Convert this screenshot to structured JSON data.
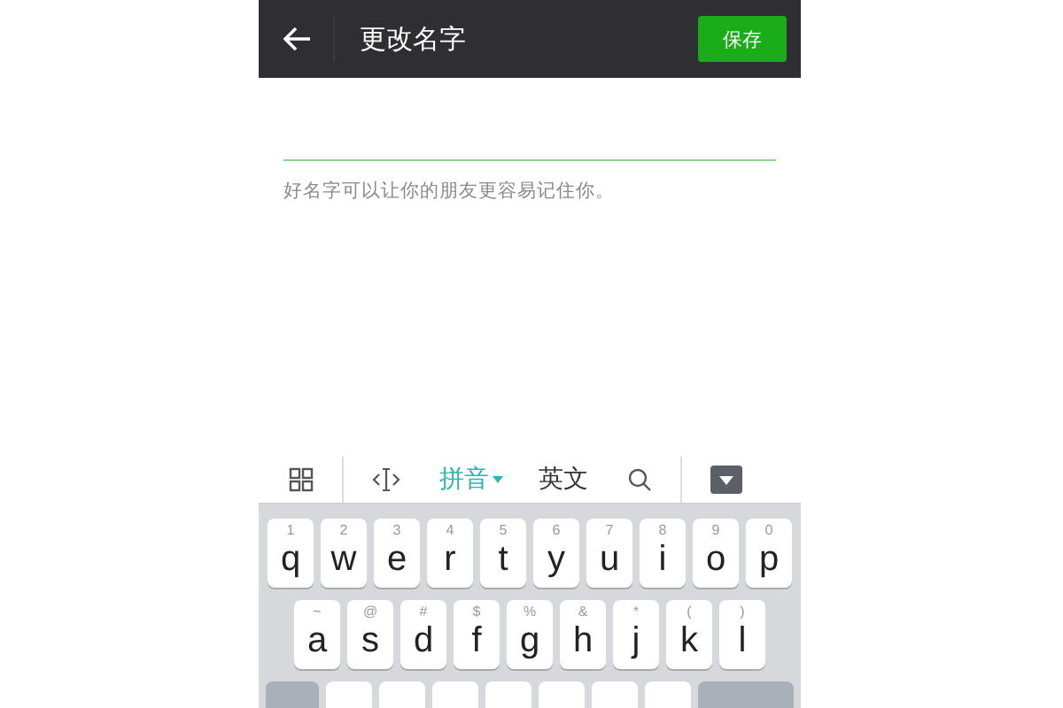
{
  "header": {
    "title": "更改名字",
    "save_button": "保存"
  },
  "name_field": {
    "help_text": "好名字可以让你的朋友更容易记住你。"
  },
  "keyboard": {
    "modes": [
      {
        "label": "拼音",
        "selected": true
      },
      {
        "label": "英文",
        "selected": false
      }
    ],
    "rows": [
      [
        {
          "key": "q",
          "hint": "1"
        },
        {
          "key": "w",
          "hint": "2"
        },
        {
          "key": "e",
          "hint": "3"
        },
        {
          "key": "r",
          "hint": "4"
        },
        {
          "key": "t",
          "hint": "5"
        },
        {
          "key": "y",
          "hint": "6"
        },
        {
          "key": "u",
          "hint": "7"
        },
        {
          "key": "i",
          "hint": "8"
        },
        {
          "key": "o",
          "hint": "9"
        },
        {
          "key": "p",
          "hint": "0"
        }
      ],
      [
        {
          "key": "a",
          "hint": "~"
        },
        {
          "key": "s",
          "hint": "@"
        },
        {
          "key": "d",
          "hint": "#"
        },
        {
          "key": "f",
          "hint": "$"
        },
        {
          "key": "g",
          "hint": "%"
        },
        {
          "key": "h",
          "hint": "&"
        },
        {
          "key": "j",
          "hint": "*"
        },
        {
          "key": "k",
          "hint": "("
        },
        {
          "key": "l",
          "hint": ")"
        }
      ]
    ]
  }
}
